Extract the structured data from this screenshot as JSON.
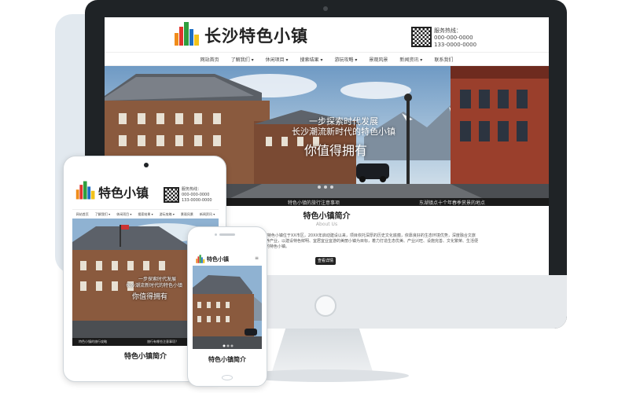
{
  "brand": {
    "logo_text": "长沙特色小镇",
    "short_logo_text": "特色小镇",
    "bar_colors": [
      "#f08c1a",
      "#e2342d",
      "#2f9e3e",
      "#1e6fc4",
      "#f2c21a"
    ]
  },
  "contact": {
    "label": "服务热线：",
    "phone_1": "000-000-0000",
    "phone_2": "133-0000-0000"
  },
  "nav": {
    "items": [
      "网站首页",
      "了解我们 ▾",
      "休闲项目 ▾",
      "搜索结果 ▾",
      "游玩攻略 ▾",
      "景观风景",
      "新闻资讯 ▾",
      "联系我们"
    ]
  },
  "banner": {
    "line_1": "一步探索时代发展",
    "line_2": "长沙潮流新时代的特色小镇",
    "line_3": "你值得拥有"
  },
  "strip": {
    "item_1": "特色小镇的旅行注意事项",
    "item_2": "东湖镇点十个年春季赏景的地点"
  },
  "about": {
    "title": "特色小镇简介",
    "subtitle": "About Us",
    "body": "XX特色小镇位于XX市区，20XX年启动建设以来，项目依托深厚的历史文化底蕴，依靠良好的生态环境优势，深度融合文旅康养产业，以建设特色鲜明、宜居宜业宜游的美丽小镇为目标，着力打造生态优美、产业兴旺、设施完善、文化繁荣、生活便利的特色小镇。",
    "button": "查看详情"
  },
  "tablet": {
    "strip_1": "特色小镇的旅行攻略",
    "strip_2": "旅行有哪些注意事项？"
  },
  "colors": {
    "monitor_frame": "#1f2326",
    "accent_dark": "#222222"
  }
}
